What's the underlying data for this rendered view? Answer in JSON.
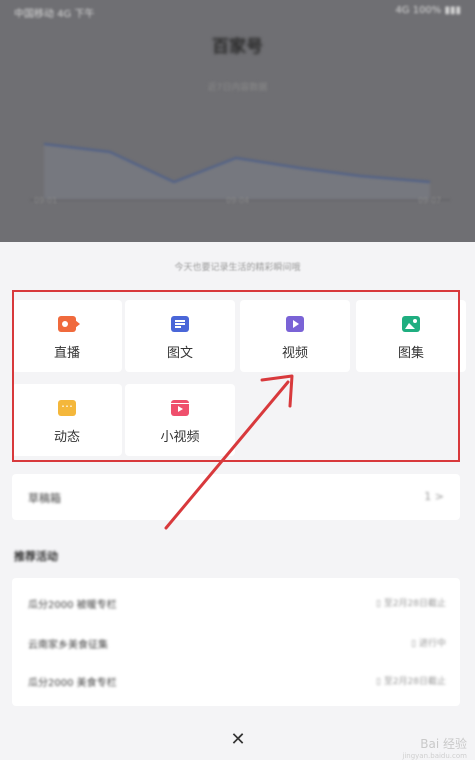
{
  "status_bar": {
    "time": "中国移动 4G 下午",
    "right": "4G 100% ▮▮▮"
  },
  "background": {
    "title": "百家号",
    "subtitle": "近7日内容数据",
    "axis_labels": [
      "09-01",
      "09-04",
      "09-07"
    ]
  },
  "sheet": {
    "header": "今天也要记录生活的精彩瞬间哦",
    "create_options": [
      {
        "label": "直播",
        "icon": "live-camera-icon",
        "color": "#f06a3d"
      },
      {
        "label": "图文",
        "icon": "article-icon",
        "color": "#4a66d8"
      },
      {
        "label": "视频",
        "icon": "video-play-icon",
        "color": "#7a63d6"
      },
      {
        "label": "图集",
        "icon": "gallery-image-icon",
        "color": "#1fae80"
      },
      {
        "label": "动态",
        "icon": "moment-chat-icon",
        "color": "#f4b73b"
      },
      {
        "label": "小视频",
        "icon": "small-video-icon",
        "color": "#ef4f6c"
      }
    ],
    "draft": {
      "label": "草稿箱",
      "value": "1 >"
    },
    "section_title": "推荐活动",
    "activities": [
      {
        "title": "瓜分2000 被暖专栏",
        "meta": "▯ 至2月28日截止"
      },
      {
        "title": "云南家乡美食征集",
        "meta": "▯ 进行中"
      },
      {
        "title": "瓜分2000 美食专栏",
        "meta": "▯ 至2月28日截止"
      }
    ],
    "close": "✕"
  },
  "watermark": {
    "brand": "Bai 经验",
    "url": "jingyan.baidu.com"
  },
  "annotation_color": "#d8393c"
}
